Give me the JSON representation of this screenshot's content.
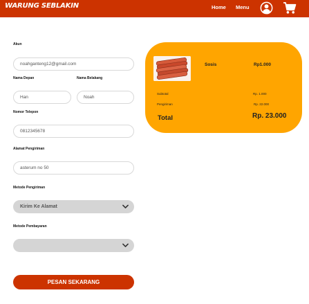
{
  "brand": "WARUNG SEBLAKIN",
  "nav": {
    "home": "Home",
    "menu": "Menu"
  },
  "form": {
    "akun_label": "Akun",
    "email_value": "noahganteng12@gmail.com",
    "first_name_label": "Nama Depan",
    "last_name_label": "Nama Belakang",
    "first_name_value": "Han",
    "last_name_value": "Noah",
    "phone_label": "Nomor Telepon",
    "phone_value": "0812345678",
    "address_label": "Alamat Pengiriman",
    "address_value": "asterum no 50",
    "shipping_label": "Metode Pengiriman",
    "shipping_value": "Kirim Ke Alamat",
    "payment_label": "Metode Pembayaran",
    "payment_value": "",
    "submit_label": "PESAN SEKARANG"
  },
  "summary": {
    "item_name": "Sosis",
    "item_price": "Rp1.000",
    "subtotal_label": "Subtotal",
    "subtotal_value": "Rp. 1.000",
    "shipping_label": "Pengiriman",
    "shipping_value": "Rp. 22.000",
    "total_label": "Total",
    "total_value": "Rp. 23.000"
  },
  "colors": {
    "primary": "#cc3300",
    "card": "#ffa500",
    "select_bg": "#d5d5d5"
  },
  "icons": {
    "user": "user-circle-icon",
    "cart": "cart-icon",
    "dropdown": "chevron-down-icon",
    "product": "sausage-image"
  }
}
